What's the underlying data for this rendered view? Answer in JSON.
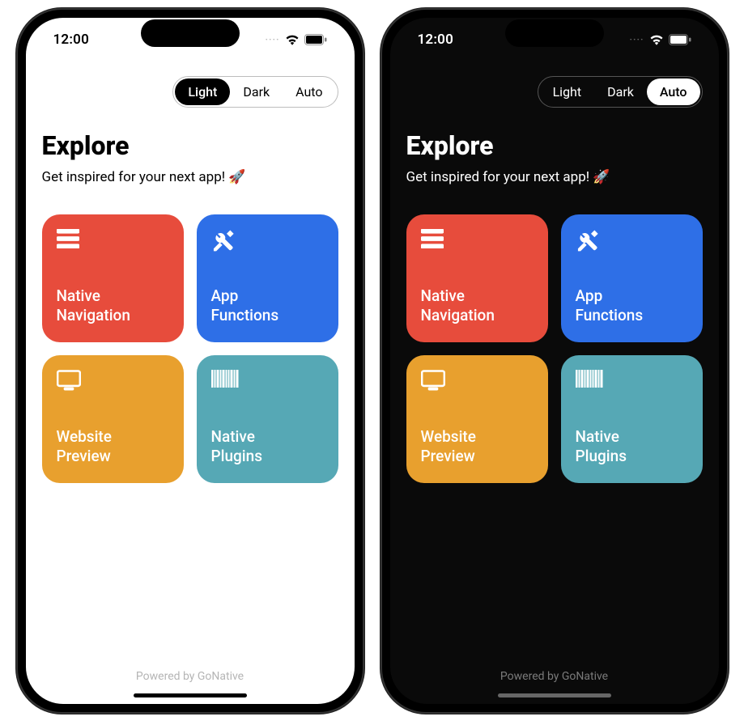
{
  "status": {
    "time": "12:00",
    "cellular_dots": "····",
    "wifi_icon": "wifi",
    "battery_icon": "battery-full"
  },
  "theme_toggle": {
    "options": [
      "Light",
      "Dark",
      "Auto"
    ],
    "active_left": "Light",
    "active_right": "Auto"
  },
  "page": {
    "title": "Explore",
    "subtitle": "Get inspired for your next app! 🚀"
  },
  "tiles": [
    {
      "label": "Native\nNavigation",
      "color": "tile-red",
      "icon": "menu-icon"
    },
    {
      "label": "App\nFunctions",
      "color": "tile-blue",
      "icon": "tools-icon"
    },
    {
      "label": "Website\nPreview",
      "color": "tile-orange",
      "icon": "monitor-icon"
    },
    {
      "label": "Native\nPlugins",
      "color": "tile-teal",
      "icon": "barcode-icon"
    }
  ],
  "footer": "Powered by GoNative"
}
